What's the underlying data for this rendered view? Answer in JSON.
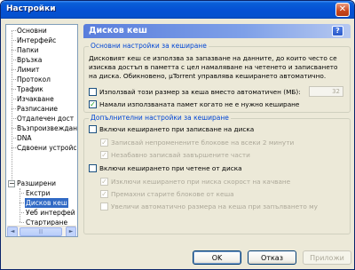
{
  "window": {
    "title": "Настройки",
    "close_symbol": "✕"
  },
  "tree": {
    "items": [
      "Основни",
      "Интерфейс",
      "Папки",
      "Връзка",
      "Лимит",
      "Протокол",
      "Трафик",
      "Изчакване",
      "Разписание",
      "Отдалечен дост",
      "Възпроизвеждан",
      "DNA",
      "Сдвоени устройс",
      "Разширени"
    ],
    "expander_symbol": "−",
    "children": [
      "Екстри",
      "Дисков кеш",
      "Уеб интерфей",
      "Стартиране"
    ],
    "selected": "Дисков кеш",
    "scroll_left": "◄",
    "scroll_right": "►",
    "scroll_grip": "|||"
  },
  "panel": {
    "title": "Дисков кеш",
    "help_label": "?",
    "basic_group": {
      "label": "Основни настройки за кеширане",
      "description": "Дисковият кеш се използва за запазване на данните, до които често се изисква достъп в паметта с цел намаляване на четенето и записването на диска. Обикновено, µTorrent управлява кеширането автоматично.",
      "override_label": "Използвай този размер за кеша вместо автоматичен (МБ):",
      "override_checked": false,
      "size_value": "32",
      "reduce_label": "Намали използваната памет когато не е нужно кеширане",
      "reduce_checked": true
    },
    "advanced_group": {
      "label": "Допълнителни настройки за кеширане",
      "write_label": "Включи кеширането при записване на диска",
      "write_checked": false,
      "write_sub1": "Записвай непроменените блокове на всеки 2 минути",
      "write_sub1_checked": true,
      "write_sub2": "Незабавно записвай завършените части",
      "write_sub2_checked": true,
      "read_label": "Включи кеширането при четене от диска",
      "read_checked": false,
      "read_sub1": "Изключи кеширането при ниска скорост на качване",
      "read_sub1_checked": true,
      "read_sub2": "Премахни старите блокове от кеша",
      "read_sub2_checked": true,
      "read_sub3": "Увеличи автоматично размера на кеша при запълването му",
      "read_sub3_checked": false
    },
    "check_symbol": "✓"
  },
  "buttons": {
    "ok": "OK",
    "cancel": "Отказ",
    "apply": "Приложи"
  }
}
